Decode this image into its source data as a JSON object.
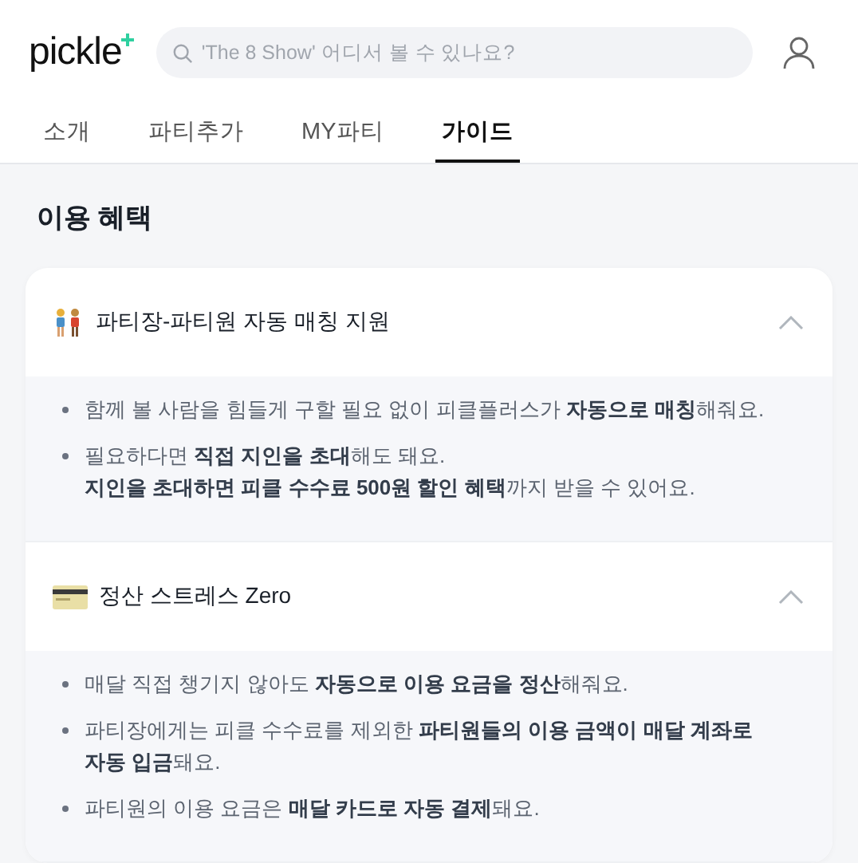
{
  "header": {
    "logo": "pickle",
    "search": {
      "placeholder": "'The 8 Show' 어디서 볼 수 있나요?"
    }
  },
  "tabs": [
    {
      "label": "소개",
      "selected": false
    },
    {
      "label": "파티추가",
      "selected": false
    },
    {
      "label": "MY파티",
      "selected": false
    },
    {
      "label": "가이드",
      "selected": true
    }
  ],
  "section_title": "이용 혜택",
  "benefits": [
    {
      "title": "파티장-파티원 자동 매칭 지원",
      "expanded": true,
      "bullets": [
        [
          "함께 볼 사람을 힘들게 구할 필요 없이 피클플러스가 **자동으로 매칭**해줘요."
        ],
        [
          "필요하다면 **직접 지인을 초대**해도 돼요.",
          "**지인을 초대하면 피클 수수료 500원 할인 혜택**까지 받을 수 있어요."
        ]
      ]
    },
    {
      "title": "정산 스트레스 Zero",
      "expanded": true,
      "bullets": [
        [
          "매달 직접 챙기지 않아도 **자동으로 이용 요금을 정산**해줘요."
        ],
        [
          "파티장에게는 피클 수수료를 제외한 **파티원들의 이용 금액이 매달 계좌로 자동 입금**돼요."
        ],
        [
          "파티원의 이용 요금은 **매달 카드로 자동 결제**돼요."
        ]
      ]
    }
  ]
}
